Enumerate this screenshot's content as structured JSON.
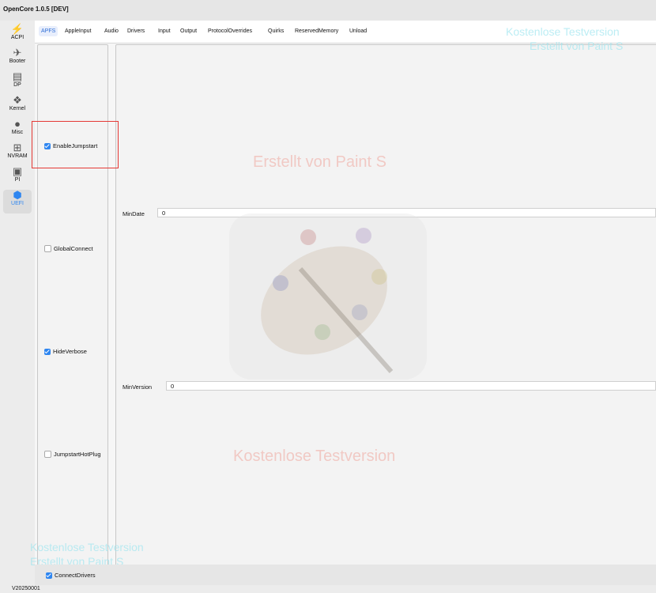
{
  "app": {
    "title": "OpenCore 1.0.5 [DEV]",
    "version": "V20250001"
  },
  "sidebar": {
    "items": [
      {
        "label": "ACPI",
        "icon": "bolt-icon",
        "active": false
      },
      {
        "label": "Booter",
        "icon": "rocket-icon",
        "active": false
      },
      {
        "label": "DP",
        "icon": "device-icon",
        "active": false
      },
      {
        "label": "Kernel",
        "icon": "kernel-icon",
        "active": false
      },
      {
        "label": "Misc",
        "icon": "misc-icon",
        "active": false
      },
      {
        "label": "NVRAM",
        "icon": "chip-icon",
        "active": false
      },
      {
        "label": "PI",
        "icon": "monitor-icon",
        "active": false
      },
      {
        "label": "UEFI",
        "icon": "cube-icon",
        "active": true
      }
    ]
  },
  "tabs": [
    "APFS",
    "AppleInput",
    "Audio",
    "Drivers",
    "Input",
    "Output",
    "ProtocolOverrides",
    "Quirks",
    "ReservedMemory",
    "Unload"
  ],
  "active_tab": "APFS",
  "checkboxes": [
    {
      "label": "EnableJumpstart",
      "checked": true
    },
    {
      "label": "GlobalConnect",
      "checked": false
    },
    {
      "label": "HideVerbose",
      "checked": true
    },
    {
      "label": "JumpstartHotPlug",
      "checked": false
    }
  ],
  "fields": [
    {
      "label": "MinDate",
      "value": "0"
    },
    {
      "label": "MinVersion",
      "value": "0"
    }
  ],
  "footer": {
    "connect_drivers_label": "ConnectDrivers",
    "connect_drivers_checked": true
  },
  "watermarks": {
    "free_trial": "Kostenlose Testversion",
    "created_with": "Erstellt von Paint S"
  },
  "colors": {
    "accent": "#2f86f0",
    "highlight": "#e53935"
  }
}
